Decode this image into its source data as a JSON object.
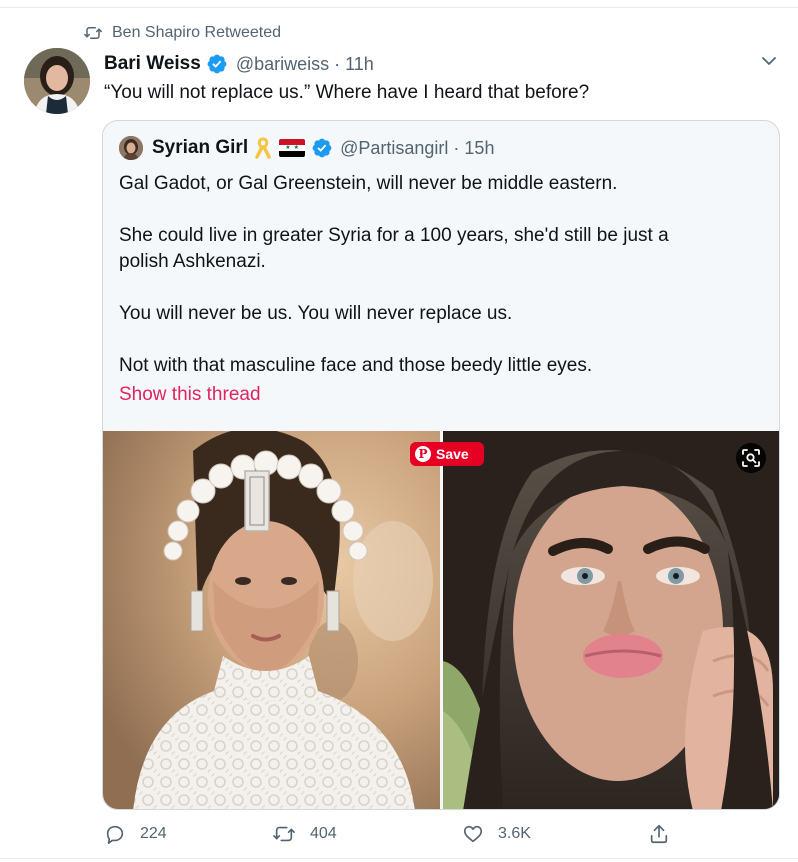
{
  "retweet": {
    "label": "Ben Shapiro Retweeted"
  },
  "tweet": {
    "author": {
      "name": "Bari Weiss",
      "handle": "@bariweiss"
    },
    "separator": "·",
    "time": "11h",
    "text": "“You will not replace us.” Where have I heard that before?"
  },
  "quote": {
    "author": {
      "name": "Syrian Girl",
      "handle": "@Partisangirl"
    },
    "separator": "·",
    "time": "15h",
    "paragraphs": [
      "Gal Gadot, or Gal Greenstein, will never be middle eastern.",
      "She could live in greater Syria for a 100 years, she'd still be just a\npolish Ashkenazi.",
      "You will never be us. You will never replace us.",
      "Not with that masculine face and those beedy little eyes."
    ],
    "show_thread": "Show this thread"
  },
  "overlays": {
    "save_label": "Save",
    "lens_icon": "visual-search-icon"
  },
  "actions": {
    "replies": "224",
    "retweets": "404",
    "likes": "3.6K"
  },
  "colors": {
    "accent_blue": "#1d9bf0",
    "link_red": "#e0245e",
    "pinterest_red": "#e60023",
    "muted_text": "#536471"
  }
}
